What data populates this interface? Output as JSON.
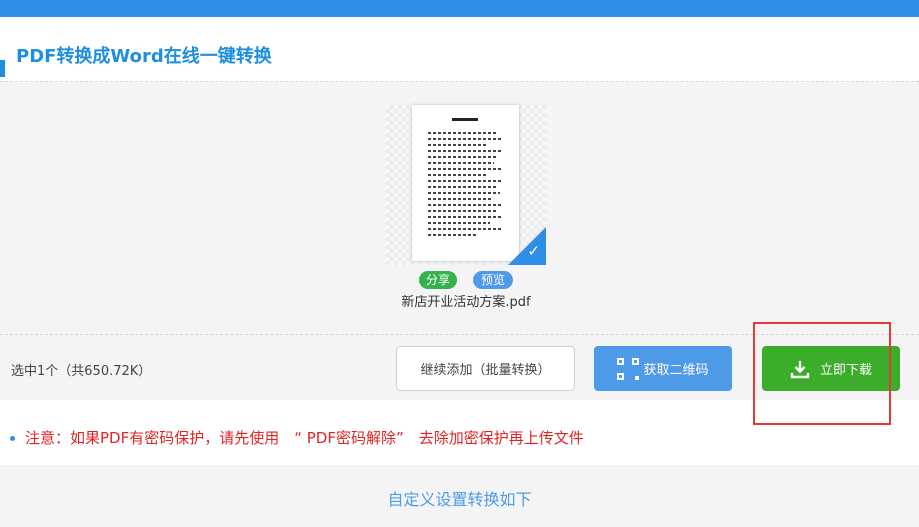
{
  "header": {
    "title": "PDF转换成Word在线一键转换"
  },
  "file": {
    "name": "新店开业活动方案.pdf",
    "share_label": "分享",
    "preview_label": "预览"
  },
  "status": {
    "selected_text": "选中1个（共650.72K）"
  },
  "actions": {
    "add_label": "继续添加（批量转换）",
    "qr_label": "获取二维码",
    "download_label": "立即下载"
  },
  "notice": {
    "text": "注意：如果PDF有密码保护，请先使用　“ PDF密码解除”　去除加密保护再上传文件"
  },
  "settings": {
    "heading": "自定义设置转换如下"
  },
  "colors": {
    "accent": "#2f8ee6",
    "download_green": "#3bad2a",
    "notice_red": "#e02424",
    "highlight_red": "#e53935"
  }
}
